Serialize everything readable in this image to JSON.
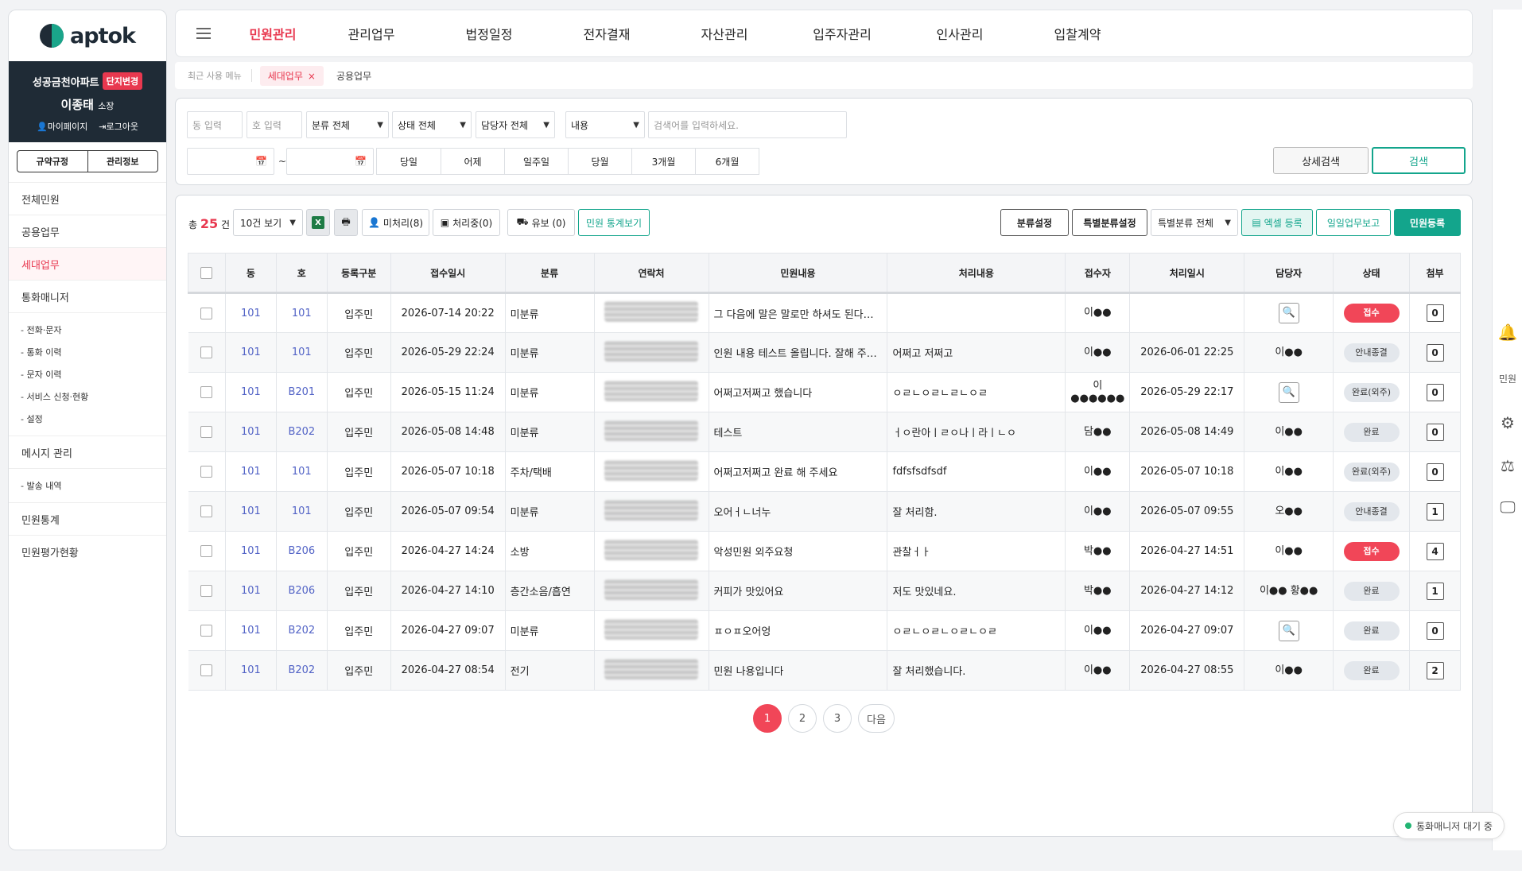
{
  "sidebar": {
    "logo": "aptok",
    "complex": "성공금천아파트",
    "change": "단지변경",
    "user": "이종태",
    "role": "소장",
    "mypage": "마이페이지",
    "logout": "로그아웃",
    "seg": [
      "규약규정",
      "관리정보"
    ],
    "menu": [
      "전체민원",
      "공용업무",
      "세대업무",
      "통화매니저"
    ],
    "sub1": [
      "- 전화·문자",
      "- 통화 이력",
      "- 문자 이력",
      "- 서비스 신청·현황",
      "- 설정"
    ],
    "msg": "메시지 관리",
    "sub2": [
      "- 발송 내역"
    ],
    "stats": "민원통계",
    "eval": "민원평가현황"
  },
  "topnav": [
    "민원관리",
    "관리업무",
    "법정일정",
    "전자결재",
    "자산관리",
    "입주자관리",
    "인사관리",
    "입찰계약"
  ],
  "recent": {
    "label": "최근 사용 메뉴",
    "active": "세대업무",
    "close": "×",
    "other": "공용업무"
  },
  "search": {
    "dong_placeholder": "동 입력",
    "ho_placeholder": "호 입력",
    "category": "분류 전체",
    "status": "상태 전체",
    "manager": "담당자 전체",
    "field": "내용",
    "keyword_placeholder": "검색어를 입력하세요.",
    "tilde": "~",
    "periods": [
      "당일",
      "어제",
      "일주일",
      "당월",
      "3개월",
      "6개월"
    ],
    "detail": "상세검색",
    "search": "검색"
  },
  "toolbar": {
    "total_prefix": "총",
    "total": "25",
    "total_suffix": "건",
    "per_page": "10건 보기",
    "unprocessed": "미처리(8)",
    "processing": "처리중(0)",
    "hold": "유보 (0)",
    "stats_view": "민원 통계보기",
    "category_set": "분류설정",
    "special_set": "특별분류설정",
    "special_all": "특별분류 전체",
    "excel": "엑셀 등록",
    "daily": "일일업무보고",
    "register": "민원등록"
  },
  "table": {
    "headers": [
      "동",
      "호",
      "등록구분",
      "접수일시",
      "분류",
      "연락처",
      "민원내용",
      "처리내용",
      "접수자",
      "처리일시",
      "담당자",
      "상태",
      "첨부"
    ],
    "rows": [
      {
        "dong": "101",
        "ho": "101",
        "reg": "입주민",
        "date": "2026-07-14 20:22",
        "cat": "미분류",
        "content": "그 다음에 말은 말로만 하셔도 된다고 말...",
        "result": "",
        "receiver": "이●●",
        "pdate": "",
        "manager": "",
        "status": "접수",
        "att": "0"
      },
      {
        "dong": "101",
        "ho": "101",
        "reg": "입주민",
        "date": "2026-05-29 22:24",
        "cat": "미분류",
        "content": "인원 내용 테스트 올립니다. 잘해 주세요.",
        "result": "어쩌고 저쩌고",
        "receiver": "이●●",
        "pdate": "2026-06-01 22:25",
        "manager": "이●●",
        "status": "안내종결",
        "att": "0"
      },
      {
        "dong": "101",
        "ho": "B201",
        "reg": "입주민",
        "date": "2026-05-15 11:24",
        "cat": "미분류",
        "content": "어쩌고저쩌고 했습니다",
        "result": "ㅇㄹㄴㅇㄹㄴㄹㄴㅇㄹ",
        "receiver": "이●●●●●●",
        "pdate": "2026-05-29 22:17",
        "manager": "",
        "status": "완료(외주)",
        "att": "0"
      },
      {
        "dong": "101",
        "ho": "B202",
        "reg": "입주민",
        "date": "2026-05-08 14:48",
        "cat": "미분류",
        "content": "테스트",
        "result": "ㅓㅇ란아ㅣㄹㅇ나ㅣ라ㅣㄴㅇ",
        "receiver": "담●●",
        "pdate": "2026-05-08 14:49",
        "manager": "이●●",
        "status": "완료",
        "att": "0"
      },
      {
        "dong": "101",
        "ho": "101",
        "reg": "입주민",
        "date": "2026-05-07 10:18",
        "cat": "주차/택배",
        "content": "어쩌고저쩌고 완료 해 주세요",
        "result": "fdfsfsdfsdf",
        "receiver": "이●●",
        "pdate": "2026-05-07 10:18",
        "manager": "이●●",
        "status": "완료(외주)",
        "att": "0"
      },
      {
        "dong": "101",
        "ho": "101",
        "reg": "입주민",
        "date": "2026-05-07 09:54",
        "cat": "미분류",
        "content": "오어ㅓㄴ너누",
        "result": "잘 처리함.",
        "receiver": "이●●",
        "pdate": "2026-05-07 09:55",
        "manager": "오●●",
        "status": "안내종결",
        "att": "1"
      },
      {
        "dong": "101",
        "ho": "B206",
        "reg": "입주민",
        "date": "2026-04-27 14:24",
        "cat": "소방",
        "content": "악성민원 외주요청",
        "result": "관찰ㅓㅏ",
        "receiver": "박●●",
        "pdate": "2026-04-27 14:51",
        "manager": "이●●",
        "status": "접수",
        "att": "4"
      },
      {
        "dong": "101",
        "ho": "B206",
        "reg": "입주민",
        "date": "2026-04-27 14:10",
        "cat": "층간소음/흡연",
        "content": "커피가 맛있어요",
        "result": "저도 맛있네요.",
        "receiver": "박●●",
        "pdate": "2026-04-27 14:12",
        "manager": "이●● 황●●",
        "status": "완료",
        "att": "1"
      },
      {
        "dong": "101",
        "ho": "B202",
        "reg": "입주민",
        "date": "2026-04-27 09:07",
        "cat": "미분류",
        "content": "ㅍㅇㅍ오어엉",
        "result": "ㅇㄹㄴㅇㄹㄴㅇㄹㄴㅇㄹ",
        "receiver": "이●●",
        "pdate": "2026-04-27 09:07",
        "manager": "",
        "status": "완료",
        "att": "0"
      },
      {
        "dong": "101",
        "ho": "B202",
        "reg": "입주민",
        "date": "2026-04-27 08:54",
        "cat": "전기",
        "content": "민원 나용입니다",
        "result": "잘 처리했습니다.",
        "receiver": "이●●",
        "pdate": "2026-04-27 08:55",
        "manager": "이●●",
        "status": "완료",
        "att": "2"
      }
    ]
  },
  "pager": [
    "1",
    "2",
    "3",
    "다음"
  ],
  "rail_label": "민원",
  "call_status": "통화매니저 대기 중"
}
